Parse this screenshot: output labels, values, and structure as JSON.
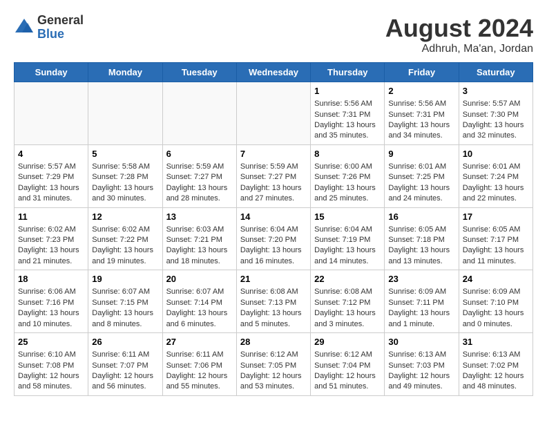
{
  "header": {
    "logo_general": "General",
    "logo_blue": "Blue",
    "month_title": "August 2024",
    "location": "Adhruh, Ma'an, Jordan"
  },
  "calendar": {
    "days_of_week": [
      "Sunday",
      "Monday",
      "Tuesday",
      "Wednesday",
      "Thursday",
      "Friday",
      "Saturday"
    ],
    "weeks": [
      [
        {
          "day": "",
          "info": ""
        },
        {
          "day": "",
          "info": ""
        },
        {
          "day": "",
          "info": ""
        },
        {
          "day": "",
          "info": ""
        },
        {
          "day": "1",
          "info": "Sunrise: 5:56 AM\nSunset: 7:31 PM\nDaylight: 13 hours and 35 minutes."
        },
        {
          "day": "2",
          "info": "Sunrise: 5:56 AM\nSunset: 7:31 PM\nDaylight: 13 hours and 34 minutes."
        },
        {
          "day": "3",
          "info": "Sunrise: 5:57 AM\nSunset: 7:30 PM\nDaylight: 13 hours and 32 minutes."
        }
      ],
      [
        {
          "day": "4",
          "info": "Sunrise: 5:57 AM\nSunset: 7:29 PM\nDaylight: 13 hours and 31 minutes."
        },
        {
          "day": "5",
          "info": "Sunrise: 5:58 AM\nSunset: 7:28 PM\nDaylight: 13 hours and 30 minutes."
        },
        {
          "day": "6",
          "info": "Sunrise: 5:59 AM\nSunset: 7:27 PM\nDaylight: 13 hours and 28 minutes."
        },
        {
          "day": "7",
          "info": "Sunrise: 5:59 AM\nSunset: 7:27 PM\nDaylight: 13 hours and 27 minutes."
        },
        {
          "day": "8",
          "info": "Sunrise: 6:00 AM\nSunset: 7:26 PM\nDaylight: 13 hours and 25 minutes."
        },
        {
          "day": "9",
          "info": "Sunrise: 6:01 AM\nSunset: 7:25 PM\nDaylight: 13 hours and 24 minutes."
        },
        {
          "day": "10",
          "info": "Sunrise: 6:01 AM\nSunset: 7:24 PM\nDaylight: 13 hours and 22 minutes."
        }
      ],
      [
        {
          "day": "11",
          "info": "Sunrise: 6:02 AM\nSunset: 7:23 PM\nDaylight: 13 hours and 21 minutes."
        },
        {
          "day": "12",
          "info": "Sunrise: 6:02 AM\nSunset: 7:22 PM\nDaylight: 13 hours and 19 minutes."
        },
        {
          "day": "13",
          "info": "Sunrise: 6:03 AM\nSunset: 7:21 PM\nDaylight: 13 hours and 18 minutes."
        },
        {
          "day": "14",
          "info": "Sunrise: 6:04 AM\nSunset: 7:20 PM\nDaylight: 13 hours and 16 minutes."
        },
        {
          "day": "15",
          "info": "Sunrise: 6:04 AM\nSunset: 7:19 PM\nDaylight: 13 hours and 14 minutes."
        },
        {
          "day": "16",
          "info": "Sunrise: 6:05 AM\nSunset: 7:18 PM\nDaylight: 13 hours and 13 minutes."
        },
        {
          "day": "17",
          "info": "Sunrise: 6:05 AM\nSunset: 7:17 PM\nDaylight: 13 hours and 11 minutes."
        }
      ],
      [
        {
          "day": "18",
          "info": "Sunrise: 6:06 AM\nSunset: 7:16 PM\nDaylight: 13 hours and 10 minutes."
        },
        {
          "day": "19",
          "info": "Sunrise: 6:07 AM\nSunset: 7:15 PM\nDaylight: 13 hours and 8 minutes."
        },
        {
          "day": "20",
          "info": "Sunrise: 6:07 AM\nSunset: 7:14 PM\nDaylight: 13 hours and 6 minutes."
        },
        {
          "day": "21",
          "info": "Sunrise: 6:08 AM\nSunset: 7:13 PM\nDaylight: 13 hours and 5 minutes."
        },
        {
          "day": "22",
          "info": "Sunrise: 6:08 AM\nSunset: 7:12 PM\nDaylight: 13 hours and 3 minutes."
        },
        {
          "day": "23",
          "info": "Sunrise: 6:09 AM\nSunset: 7:11 PM\nDaylight: 13 hours and 1 minute."
        },
        {
          "day": "24",
          "info": "Sunrise: 6:09 AM\nSunset: 7:10 PM\nDaylight: 13 hours and 0 minutes."
        }
      ],
      [
        {
          "day": "25",
          "info": "Sunrise: 6:10 AM\nSunset: 7:08 PM\nDaylight: 12 hours and 58 minutes."
        },
        {
          "day": "26",
          "info": "Sunrise: 6:11 AM\nSunset: 7:07 PM\nDaylight: 12 hours and 56 minutes."
        },
        {
          "day": "27",
          "info": "Sunrise: 6:11 AM\nSunset: 7:06 PM\nDaylight: 12 hours and 55 minutes."
        },
        {
          "day": "28",
          "info": "Sunrise: 6:12 AM\nSunset: 7:05 PM\nDaylight: 12 hours and 53 minutes."
        },
        {
          "day": "29",
          "info": "Sunrise: 6:12 AM\nSunset: 7:04 PM\nDaylight: 12 hours and 51 minutes."
        },
        {
          "day": "30",
          "info": "Sunrise: 6:13 AM\nSunset: 7:03 PM\nDaylight: 12 hours and 49 minutes."
        },
        {
          "day": "31",
          "info": "Sunrise: 6:13 AM\nSunset: 7:02 PM\nDaylight: 12 hours and 48 minutes."
        }
      ]
    ]
  }
}
